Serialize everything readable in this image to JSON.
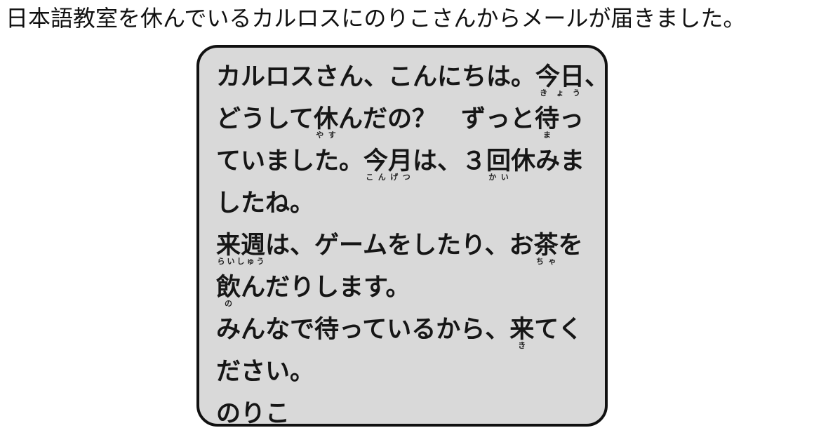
{
  "instruction": "日本語教室を休んでいるカルロスにのりこさんからメールが届きました。",
  "mail": {
    "lines": [
      [
        {
          "text": "カルロスさん、こんにちは。"
        },
        {
          "text": "今日",
          "ruby": "きょう"
        },
        {
          "text": "、"
        }
      ],
      [
        {
          "text": "どうして"
        },
        {
          "text": "休",
          "ruby": "やす"
        },
        {
          "text": "んだの？　ずっと"
        },
        {
          "text": "待",
          "ruby": "ま"
        },
        {
          "text": "っ"
        }
      ],
      [
        {
          "text": "ていました。"
        },
        {
          "text": "今月",
          "ruby": "こんげつ"
        },
        {
          "text": "は、３"
        },
        {
          "text": "回",
          "ruby": "かい"
        },
        {
          "text": "休みま"
        }
      ],
      [
        {
          "text": "したね。"
        }
      ],
      [
        {
          "text": "来週",
          "ruby": "らいしゅう"
        },
        {
          "text": "は、ゲームをしたり、お"
        },
        {
          "text": "茶",
          "ruby": "ちゃ"
        },
        {
          "text": "を"
        }
      ],
      [
        {
          "text": "飲",
          "ruby": "の"
        },
        {
          "text": "んだりします。"
        }
      ],
      [
        {
          "text": "みんなで待っているから、"
        },
        {
          "text": "来",
          "ruby": "き"
        },
        {
          "text": "てく"
        }
      ],
      [
        {
          "text": "ださい。"
        }
      ],
      [
        {
          "text": "のりこ"
        }
      ]
    ]
  }
}
